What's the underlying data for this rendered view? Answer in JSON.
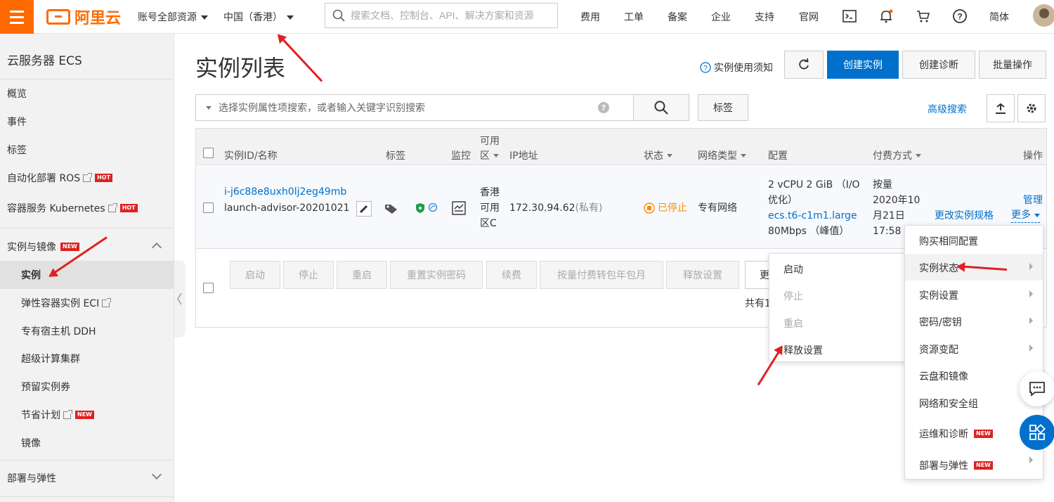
{
  "topbar": {
    "logo_text": "阿里云",
    "account_scope": "账号全部资源",
    "region": "中国（香港）",
    "search_placeholder": "搜索文档、控制台、API、解决方案和资源",
    "links": [
      "费用",
      "工单",
      "备案",
      "企业",
      "支持",
      "官网"
    ],
    "lang": "简体"
  },
  "sidebar": {
    "title": "云服务器 ECS",
    "items_top": [
      {
        "label": "概览"
      },
      {
        "label": "事件"
      },
      {
        "label": "标签"
      },
      {
        "label": "自动化部署 ROS",
        "badge": "HOT",
        "external": true
      },
      {
        "label": "容器服务 Kubernetes",
        "badge": "HOT",
        "external": true
      }
    ],
    "group_instances": {
      "label": "实例与镜像",
      "badge": "NEW"
    },
    "sub_items": [
      {
        "label": "实例",
        "active": true
      },
      {
        "label": "弹性容器实例 ECI",
        "external": true
      },
      {
        "label": "专有宿主机 DDH"
      },
      {
        "label": "超级计算集群"
      },
      {
        "label": "预留实例券"
      },
      {
        "label": "节省计划",
        "badge": "NEW",
        "external": true
      },
      {
        "label": "镜像"
      }
    ],
    "group_deploy": {
      "label": "部署与弹性"
    }
  },
  "main": {
    "title": "实例列表",
    "notice_link": "实例使用须知",
    "buttons": {
      "create": "创建实例",
      "diagnose": "创建诊断",
      "batch": "批量操作"
    },
    "filter_placeholder": "选择实例属性项搜索，或者输入关键字识别搜索",
    "tag_button": "标签",
    "advanced_search": "高级搜索"
  },
  "table": {
    "headers": {
      "id_name": "实例ID/名称",
      "tags": "标签",
      "monitor": "监控",
      "zone_line1": "可用",
      "zone_line2": "区",
      "ip": "IP地址",
      "status": "状态",
      "network": "网络类型",
      "config": "配置",
      "billing": "付费方式",
      "ops": "操作"
    },
    "row": {
      "instance_id": "i-j6c88e8uxh0lj2eg49mb",
      "instance_name": "launch-advisor-20201021",
      "zone_1": "香港",
      "zone_2": "可用",
      "zone_3": "区C",
      "ip": "172.30.94.62",
      "ip_type": "(私有)",
      "status": "已停止",
      "network": "专有网络",
      "config_1": "2 vCPU 2 GiB （I/O",
      "config_2": "优化）",
      "config_type": "ecs.t6-c1m1.large",
      "config_bw": "80Mbps （峰值）",
      "billing_1": "按量",
      "billing_2": "2020年10",
      "billing_3": "月21日",
      "billing_4": "17:58",
      "op_manage": "管理",
      "op_change": "更改实例规格",
      "op_more": "更多"
    },
    "batch_buttons": [
      "启动",
      "停止",
      "重启",
      "重置实例密码",
      "续费",
      "按量付费转包年包月",
      "释放设置"
    ],
    "batch_more_partial": "更",
    "total_partial": "共有1"
  },
  "more_menu": {
    "items": [
      {
        "label": "购买相同配置"
      },
      {
        "label": "实例状态",
        "submenu": true
      },
      {
        "label": "实例设置",
        "submenu": true
      },
      {
        "label": "密码/密钥",
        "submenu": true
      },
      {
        "label": "资源变配",
        "submenu": true
      },
      {
        "label": "云盘和镜像"
      },
      {
        "label": "网络和安全组"
      },
      {
        "label": "运维和诊断",
        "badge": "NEW"
      },
      {
        "label": "部署与弹性",
        "badge": "NEW",
        "submenu": true
      }
    ]
  },
  "status_submenu": {
    "items": [
      {
        "label": "启动",
        "disabled": false
      },
      {
        "label": "停止",
        "disabled": true
      },
      {
        "label": "重启",
        "disabled": true
      },
      {
        "label": "释放设置",
        "disabled": false
      }
    ]
  },
  "colors": {
    "brand": "#ff6a00",
    "primary": "#0070cc",
    "annotation": "#e02020",
    "stopped": "#ff8a00"
  }
}
